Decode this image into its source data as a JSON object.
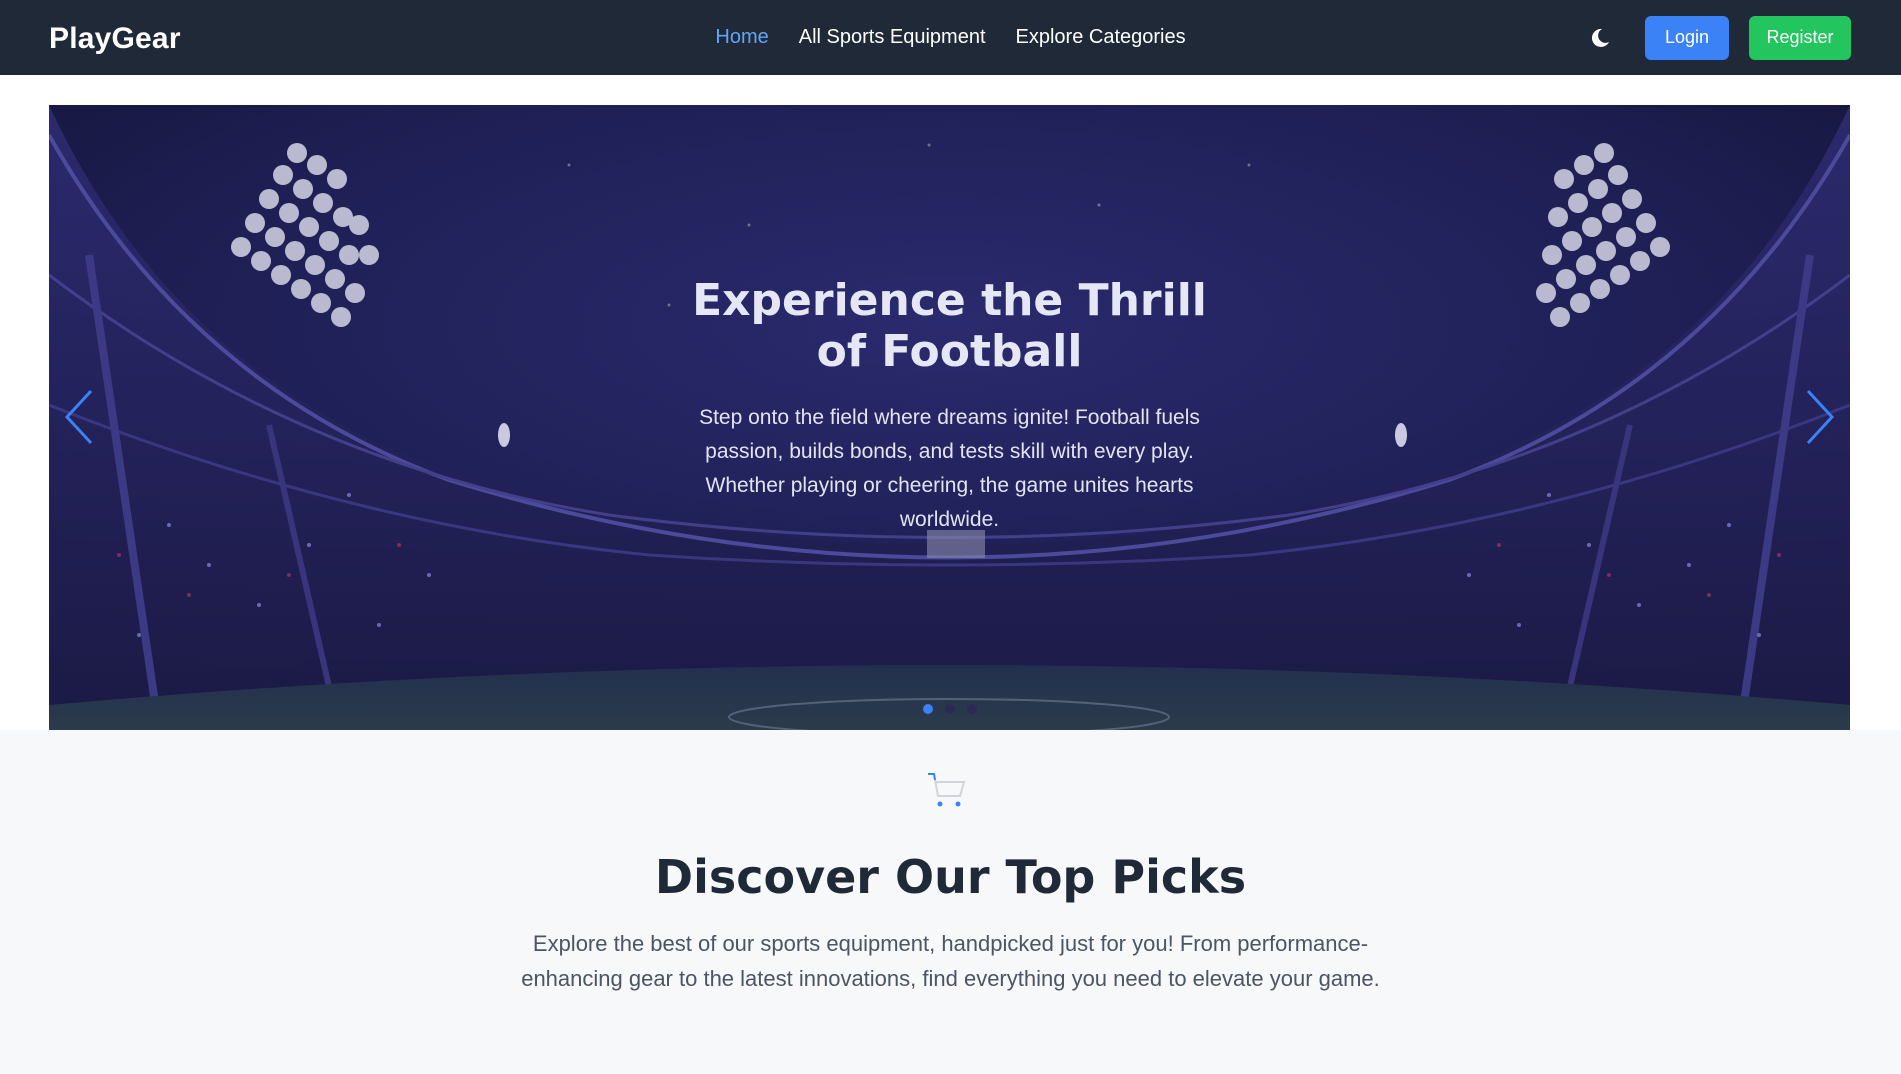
{
  "brand": {
    "name": "PlayGear"
  },
  "nav": {
    "items": [
      {
        "label": "Home",
        "active": true
      },
      {
        "label": "All Sports Equipment",
        "active": false
      },
      {
        "label": "Explore Categories",
        "active": false
      }
    ],
    "theme_icon": "moon-icon",
    "login_label": "Login",
    "register_label": "Register"
  },
  "hero": {
    "title": "Experience the Thrill of Football",
    "text": "Step onto the field where dreams ignite! Football fuels passion, builds bonds, and tests skill with every play. Whether playing or cheering, the game unites hearts worldwide.",
    "prev_icon": "chevron-left-icon",
    "next_icon": "chevron-right-icon",
    "slides_count": 3,
    "active_slide": 1
  },
  "top_picks": {
    "icon": "shopping-cart-icon",
    "title": "Discover Our Top Picks",
    "text": "Explore the best of our sports equipment, handpicked just for you! From performance-enhancing gear to the latest innovations, find everything you need to elevate your game."
  },
  "colors": {
    "navbar_bg": "#1f2937",
    "active_link": "#60a5fa",
    "login_button": "#3b82f6",
    "register_button": "#22c55e",
    "page_bg": "#f7f8fa"
  }
}
